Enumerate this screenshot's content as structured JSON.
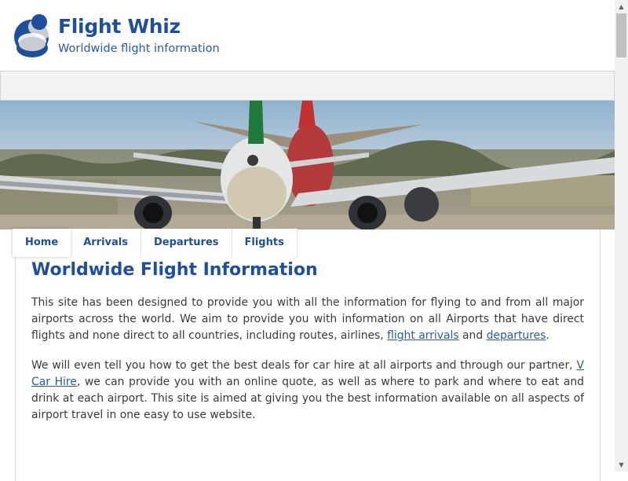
{
  "header": {
    "title": "Flight Whiz",
    "subtitle": "Worldwide flight information",
    "logo_icon": "globe-swirl-logo",
    "brand_color": "#1e4f9a"
  },
  "tabs": [
    {
      "label": "Home",
      "active": true
    },
    {
      "label": "Arrivals",
      "active": false
    },
    {
      "label": "Departures",
      "active": false
    },
    {
      "label": "Flights",
      "active": false
    }
  ],
  "hero": {
    "icon": "airplanes-on-runway-photo"
  },
  "main": {
    "title": "Worldwide Flight Information",
    "para1": {
      "text_a": "This site has been designed to provide you with all the information for flying to and from all major airports across the world. We aim to provide you with information on all Airports that have direct flights and none direct to all countries, including routes, airlines, ",
      "link1": "flight arrivals",
      "text_b": " and ",
      "link2": "departures",
      "text_c": "."
    },
    "para2": {
      "text_a": "We will even tell you how to get the best deals for car hire at all airports and through our partner, ",
      "link1": "V Car Hire",
      "text_b": ", we can provide you with an online quote, as well as where to park and where to eat and drink at each airport. This site is aimed at giving you the best information available on all aspects of airport travel in one easy to use website."
    }
  },
  "scrollbar": {
    "up_icon": "arrow-up-icon",
    "down_icon": "arrow-down-icon"
  }
}
